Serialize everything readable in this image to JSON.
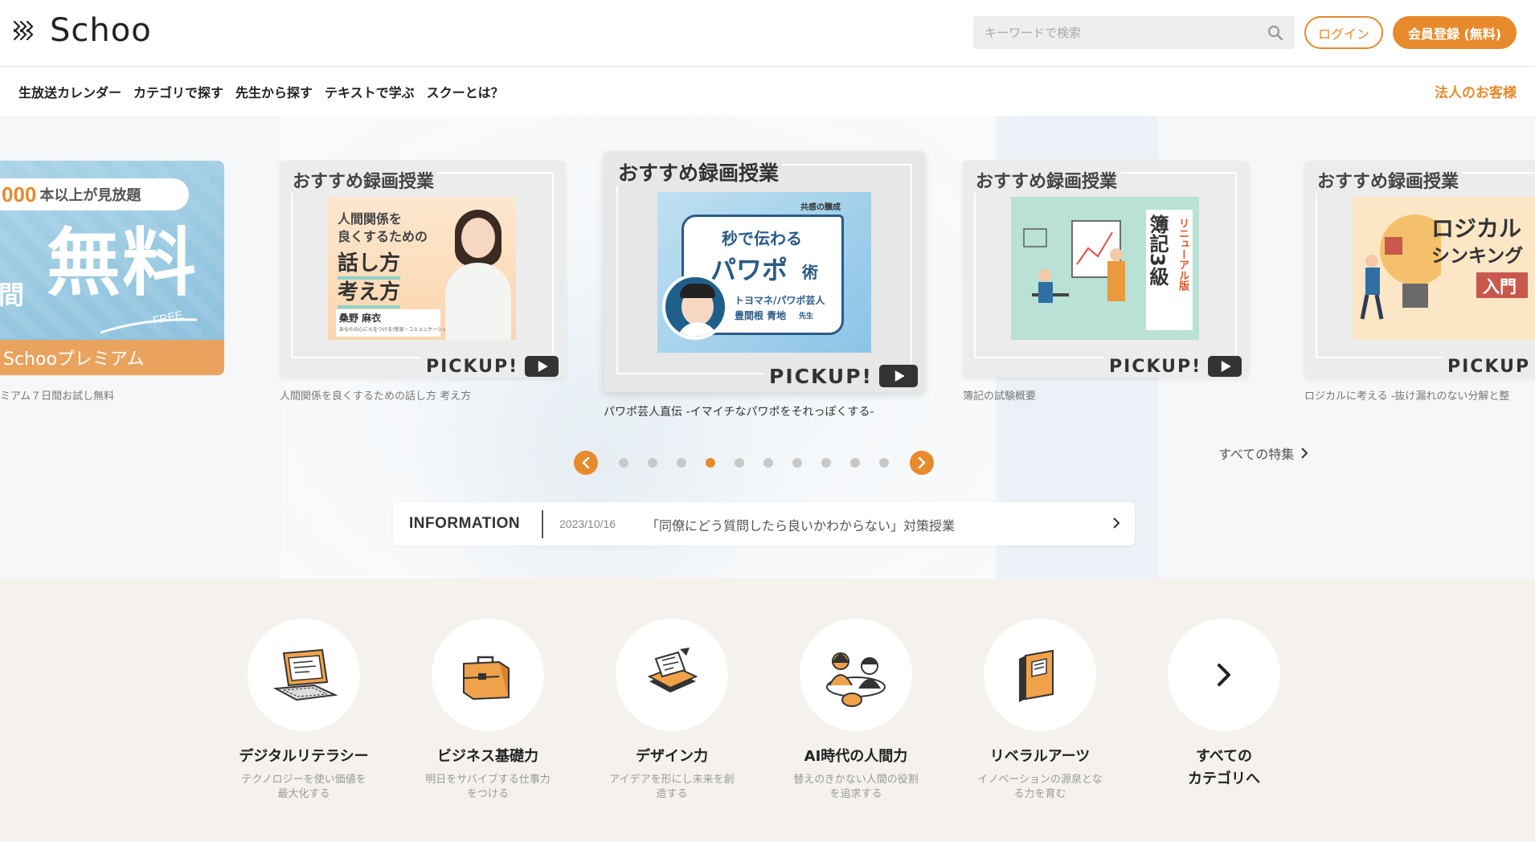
{
  "header": {
    "logo_text": "Schoo",
    "search_placeholder": "キーワードで検索",
    "login_label": "ログイン",
    "register_label": "会員登録 (無料)"
  },
  "nav": {
    "items": [
      "生放送カレンダー",
      "カテゴリで探す",
      "先生から探す",
      "テキストで学ぶ",
      "スクーとは？"
    ],
    "corporate_label": "法人のお客様"
  },
  "carousel": {
    "slides": [
      {
        "banner_count": "000",
        "banner_count_suffix": "本以上が見放題",
        "banner_main": "無料",
        "banner_left": "間",
        "banner_free": "FREE",
        "banner_bottom": "Schooプレミアム",
        "caption": "ミアム７日間お試し無料"
      },
      {
        "label": "おすすめ録画授業",
        "thumb_line1": "人間関係を",
        "thumb_line2": "良くするための",
        "thumb_big1": "話し方",
        "thumb_big2": "考え方",
        "thumb_name": "桑野 麻衣",
        "thumb_sub": "あなたの心に火をつける!受容・コミュニケーション教育者",
        "pickup": "PICKUP!",
        "caption": "人間関係を良くするための話し方 考え方"
      },
      {
        "label": "おすすめ録画授業",
        "thumb_tag": "共感の醸成",
        "thumb_line1": "秒で伝わる",
        "thumb_big": "パワポ",
        "thumb_big_suffix": "術",
        "thumb_sub1": "トヨマネ/パワポ芸人",
        "thumb_sub2": "豊間根 青地",
        "thumb_sub2_suffix": "先生",
        "pickup": "PICKUP!",
        "caption": "パワポ芸人直伝 -イマイチなパワポをそれっぽくする-"
      },
      {
        "label": "おすすめ録画授業",
        "thumb_title": "簿記3級",
        "thumb_side": "リニューアル版",
        "pickup": "PICKUP!",
        "caption": "簿記の試験概要"
      },
      {
        "label": "おすすめ録画授業",
        "thumb_line1": "ロジカル",
        "thumb_line2": "シンキング",
        "thumb_badge": "入門",
        "pickup": "PICKUP",
        "caption": "ロジカルに考える -抜け漏れのない分解と整"
      }
    ],
    "dot_count": 10,
    "active_dot": 3,
    "prev_label": "‹",
    "next_label": "›",
    "all_features_label": "すべての特集"
  },
  "information": {
    "label": "INFORMATION",
    "date": "2023/10/16",
    "title": "「同僚にどう質問したら良いかわからない」対策授業"
  },
  "categories": [
    {
      "title": "デジタルリテラシー",
      "desc1": "テクノロジーを使い価値を",
      "desc2": "最大化する",
      "icon": "laptop-icon"
    },
    {
      "title": "ビジネス基礎力",
      "desc1": "明日をサバイブする仕事力",
      "desc2": "をつける",
      "icon": "briefcase-icon"
    },
    {
      "title": "デザイン力",
      "desc1": "アイデアを形にし未来を創",
      "desc2": "造する",
      "icon": "design-icon"
    },
    {
      "title": "AI時代の人間力",
      "desc1": "替えのきかない人間の役割",
      "desc2": "を追求する",
      "icon": "people-icon"
    },
    {
      "title": "リベラルアーツ",
      "desc1": "イノベーションの源泉とな",
      "desc2": "る力を育む",
      "icon": "book-icon"
    },
    {
      "title1": "すべての",
      "title2": "カテゴリへ",
      "icon": "chevron-right-icon"
    }
  ],
  "colors": {
    "accent": "#e78a2c",
    "category_bg": "#f5f2ed",
    "dot_inactive": "#c8c8c8"
  }
}
